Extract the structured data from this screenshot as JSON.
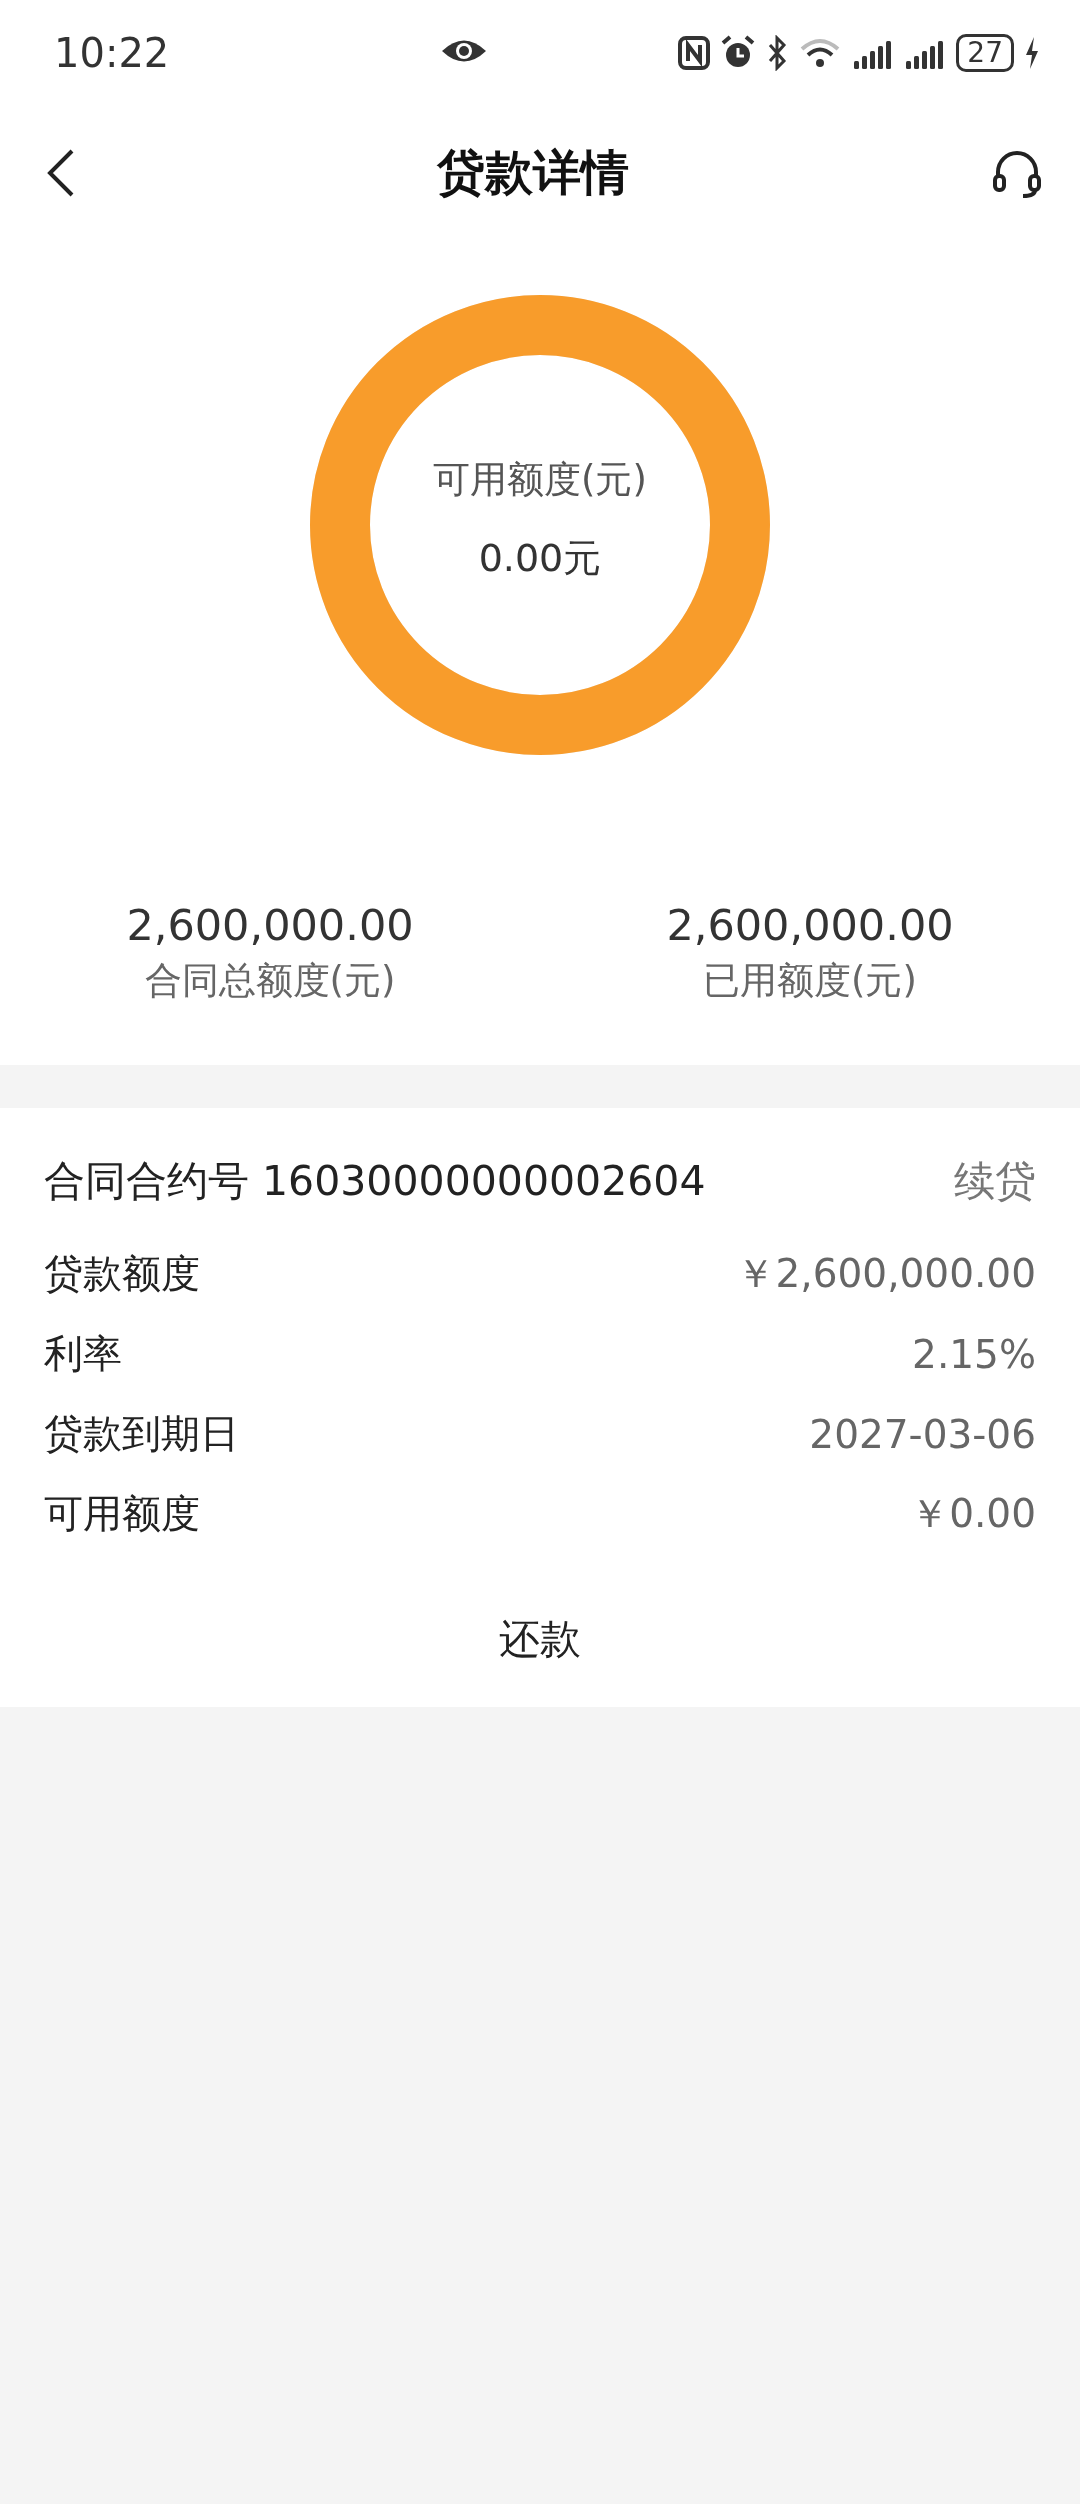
{
  "status_bar": {
    "time": "10:22",
    "battery": "27"
  },
  "header": {
    "title": "贷款详情"
  },
  "usage_ring": {
    "label": "可用额度(元)",
    "value": "0.00元",
    "level": 1
  },
  "summary": [
    {
      "value": "2,600,000.00",
      "label": "合同总额度(元)"
    },
    {
      "value": "2,600,000.00",
      "label": "已用额度(元)"
    }
  ],
  "contract": {
    "label": "合同合约号",
    "number": "16030000000002604",
    "tag": "续贷",
    "rows": [
      {
        "label": "贷款额度",
        "value": "￥2,600,000.00"
      },
      {
        "label": "利率",
        "value": "2.15%"
      },
      {
        "label": "贷款到期日",
        "value": "2027-03-06"
      },
      {
        "label": "可用额度",
        "value": "￥0.00"
      }
    ],
    "button": "还款"
  }
}
